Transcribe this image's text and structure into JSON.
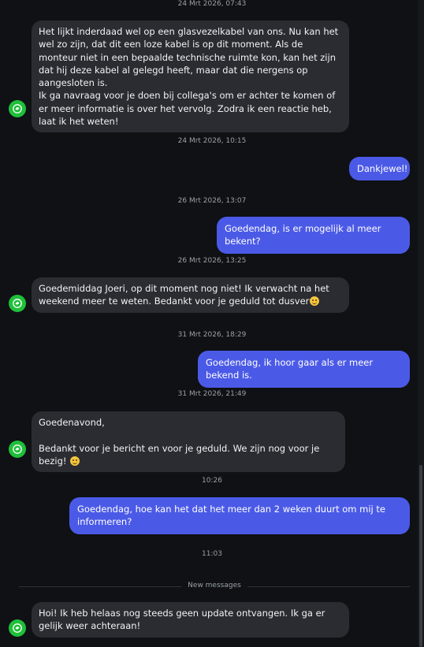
{
  "messages": [
    {
      "type": "timestamp",
      "text": "24 Mrt 2026, 07:43"
    },
    {
      "type": "incoming",
      "text": "Het lijkt inderdaad wel op een glasvezelkabel van ons. Nu kan het wel zo zijn, dat dit een loze kabel is op dit moment. Als de monteur niet in een bepaalde technische ruimte kon, kan het zijn dat hij deze kabel al gelegd heeft, maar dat die nergens op aangesloten is.\nIk ga navraag voor je doen bij collega's om er achter te komen of er meer informatie is over het vervolg. Zodra ik een reactie heb, laat ik het weten!"
    },
    {
      "type": "timestamp",
      "text": "24 Mrt 2026, 10:15"
    },
    {
      "type": "outgoing",
      "text": "Dankjewel!"
    },
    {
      "type": "timestamp",
      "text": "26 Mrt 2026, 13:07"
    },
    {
      "type": "outgoing",
      "text": "Goedendag, is er mogelijk al meer bekent?"
    },
    {
      "type": "timestamp",
      "text": "26 Mrt 2026, 13:25"
    },
    {
      "type": "incoming",
      "text": "Goedemiddag Joeri, op dit moment nog niet! Ik verwacht na het weekend meer te weten. Bedankt voor je geduld tot dusver",
      "emoji": "smiling-face-icon"
    },
    {
      "type": "timestamp",
      "text": "31 Mrt 2026, 18:29"
    },
    {
      "type": "outgoing",
      "text": "Goedendag, ik hoor gaar als er meer bekend is."
    },
    {
      "type": "timestamp",
      "text": "31 Mrt 2026, 21:49"
    },
    {
      "type": "incoming",
      "text": "Goedenavond,\n\nBedankt voor je bericht en voor je geduld. We zijn nog voor je bezig!",
      "emoji": "smiling-face-icon"
    },
    {
      "type": "timestamp",
      "text": "10:26"
    },
    {
      "type": "outgoing",
      "text": "Goedendag, hoe kan het dat het meer dan 2 weken duurt om mij te informeren?"
    },
    {
      "type": "timestamp",
      "text": "11:03"
    },
    {
      "type": "divider",
      "text": "New messages"
    },
    {
      "type": "incoming",
      "text": "Hoi! Ik heb helaas nog steeds geen update ontvangen. Ik ga er gelijk weer achteraan!"
    }
  ],
  "colors": {
    "background": "#0f1114",
    "incoming_bubble": "#2a2c31",
    "outgoing_bubble": "#4b5ae6",
    "avatar": "#1fbf3a",
    "timestamp_text": "#9aa0a8"
  }
}
